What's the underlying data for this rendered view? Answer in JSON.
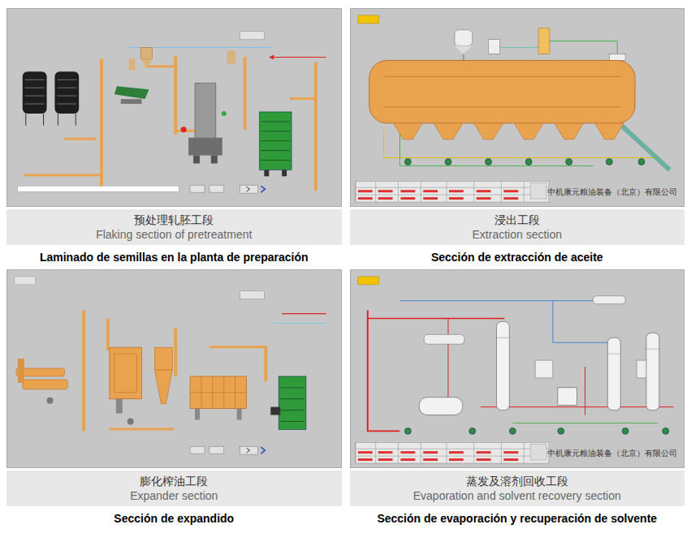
{
  "panels": [
    {
      "kind": "flaking",
      "title_zh": "预处理轧胚工段",
      "title_en": "Flaking section of pretreatment",
      "caption_es": "Laminado de semillas en la planta de preparación"
    },
    {
      "kind": "extraction",
      "title_zh": "浸出工段",
      "title_en": "Extraction section",
      "caption_es": "Sección de extracción de aceite",
      "company": "中机康元粮油装备（北京）有限公司"
    },
    {
      "kind": "expander",
      "title_zh": "膨化榨油工段",
      "title_en": "Expander section",
      "caption_es": "Sección de expandido"
    },
    {
      "kind": "evaporation",
      "title_zh": "蒸发及溶剂回收工段",
      "title_en": "Evaporation and solvent recovery section",
      "caption_es": "Sección de evaporación y recuperación de solvente",
      "company": "中机康元粮油装备（北京）有限公司"
    }
  ]
}
